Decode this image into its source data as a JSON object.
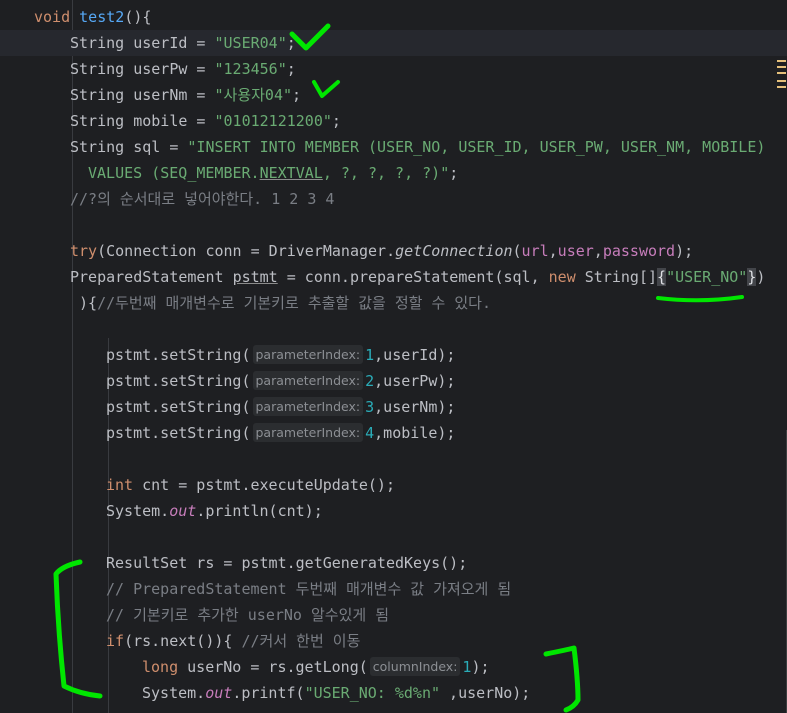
{
  "code": {
    "l1": {
      "void": "void",
      "name": "test2",
      "tail": "(){"
    },
    "l2": {
      "type": "String",
      "decl": " userId = ",
      "value": "\"USER04\"",
      "end": ";"
    },
    "l3": {
      "type": "String",
      "decl": " userPw = ",
      "value": "\"123456\"",
      "end": ";"
    },
    "l4": {
      "type": "String",
      "decl": " userNm = ",
      "value": "\"사용자04\"",
      "end": ";"
    },
    "l5": {
      "type": "String",
      "decl": " mobile = ",
      "value": "\"01012121200\"",
      "end": ";"
    },
    "l6": {
      "type": "String",
      "decl": " sql = ",
      "value": "\"INSERT INTO MEMBER (USER_NO, USER_ID, USER_PW, USER_NM, MOBILE)"
    },
    "l7": {
      "a": "VALUES (SEQ_MEMBER.",
      "nextval": "NEXTVAL",
      "b": ", ?, ?, ?, ?)\"",
      "end": ";"
    },
    "l8": {
      "comment": "//?의 순서대로 넣어야한다. 1 2 3 4"
    },
    "l9": {
      "try": "try",
      "a": "(Connection conn = DriverManager.",
      "getconn": "getConnection",
      "p1": "url",
      "c1": ",",
      "p2": "user",
      "c2": ",",
      "p3": "password",
      "end": ");"
    },
    "l10": {
      "a": "PreparedStatement ",
      "pstmt": "pstmt",
      "b": " = conn.prepareStatement(sql, ",
      "new": "new",
      "c": " String[]",
      "brace": "{",
      "str": "\"USER_NO\"",
      "brace2": "}",
      "end": ")"
    },
    "l11": {
      "a": "){",
      "comment": "//두번째 매개변수로 기본키로 추출할 값을 정할 수 있다."
    },
    "l12": {
      "a": "pstmt.setString(",
      "hint": "parameterIndex:",
      "num": "1",
      "b": ",userId);"
    },
    "l13": {
      "a": "pstmt.setString(",
      "hint": "parameterIndex:",
      "num": "2",
      "b": ",userPw);"
    },
    "l14": {
      "a": "pstmt.setString(",
      "hint": "parameterIndex:",
      "num": "3",
      "b": ",userNm);"
    },
    "l15": {
      "a": "pstmt.setString(",
      "hint": "parameterIndex:",
      "num": "4",
      "b": ",mobile);"
    },
    "l16": {
      "int": "int",
      "b": " cnt = pstmt.executeUpdate();"
    },
    "l17": {
      "a": "System.",
      "out": "out",
      "b": ".println(cnt);"
    },
    "l18": {
      "a": "ResultSet rs = pstmt.getGeneratedKeys();"
    },
    "l19": {
      "comment": "// PreparedStatement 두번째 매개변수 값 가져오게 됨"
    },
    "l20": {
      "comment": "// 기본키로 추가한 userNo 알수있게 됨"
    },
    "l21": {
      "if": "if",
      "a": "(rs.next()){ ",
      "comment": "//커서 한번 이동"
    },
    "l22": {
      "long": "long",
      "a": " userNo = rs.getLong(",
      "hint": "columnIndex:",
      "num": "1",
      "b": ");"
    },
    "l23": {
      "a": "System.",
      "out": "out",
      "b": ".printf(",
      "str": "\"USER_NO: %d%n\"",
      "c": " ,userNo);"
    }
  },
  "colors": {
    "background": "#1e1f22",
    "annotation": "#00e600",
    "keyword": "#cf8e6d",
    "string": "#6aab73",
    "comment": "#7a7e85",
    "method": "#56a8f5",
    "number": "#2aacb8"
  }
}
